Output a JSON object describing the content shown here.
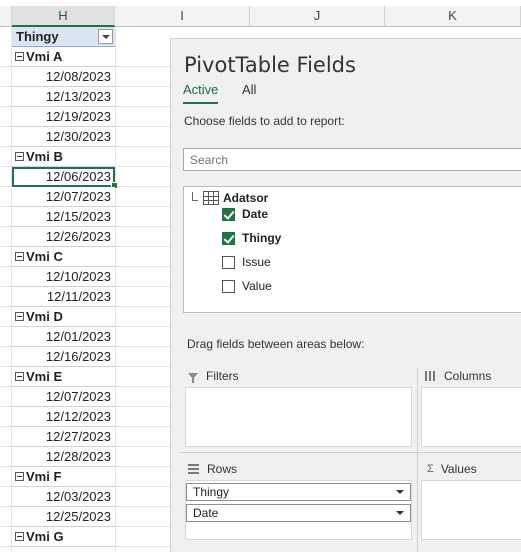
{
  "sheet": {
    "columns": [
      "H",
      "I",
      "J",
      "K"
    ],
    "header_label": "Thingy",
    "rows": [
      {
        "type": "group",
        "text": "Vmi A"
      },
      {
        "type": "date",
        "text": "12/08/2023"
      },
      {
        "type": "date",
        "text": "12/13/2023"
      },
      {
        "type": "date",
        "text": "12/19/2023"
      },
      {
        "type": "date",
        "text": "12/30/2023"
      },
      {
        "type": "group",
        "text": "Vmi B"
      },
      {
        "type": "date",
        "text": "12/06/2023",
        "active": true
      },
      {
        "type": "date",
        "text": "12/07/2023"
      },
      {
        "type": "date",
        "text": "12/15/2023"
      },
      {
        "type": "date",
        "text": "12/26/2023"
      },
      {
        "type": "group",
        "text": "Vmi C"
      },
      {
        "type": "date",
        "text": "12/10/2023"
      },
      {
        "type": "date",
        "text": "12/11/2023"
      },
      {
        "type": "group",
        "text": "Vmi D"
      },
      {
        "type": "date",
        "text": "12/01/2023"
      },
      {
        "type": "date",
        "text": "12/16/2023"
      },
      {
        "type": "group",
        "text": "Vmi E"
      },
      {
        "type": "date",
        "text": "12/07/2023"
      },
      {
        "type": "date",
        "text": "12/12/2023"
      },
      {
        "type": "date",
        "text": "12/27/2023"
      },
      {
        "type": "date",
        "text": "12/28/2023"
      },
      {
        "type": "group",
        "text": "Vmi F"
      },
      {
        "type": "date",
        "text": "12/03/2023"
      },
      {
        "type": "date",
        "text": "12/25/2023"
      },
      {
        "type": "group",
        "text": "Vmi G"
      }
    ]
  },
  "pivot": {
    "title": "PivotTable Fields",
    "tabs": [
      "Active",
      "All"
    ],
    "active_tab": "Active",
    "instruction": "Choose fields to add to report:",
    "search_placeholder": "Search",
    "table_name": "Adatsor",
    "fields": [
      {
        "name": "Date",
        "checked": true
      },
      {
        "name": "Thingy",
        "checked": true
      },
      {
        "name": "Issue",
        "checked": false
      },
      {
        "name": "Value",
        "checked": false
      }
    ],
    "drag_label": "Drag fields between areas below:",
    "areas": {
      "filters": "Filters",
      "columns": "Columns",
      "rows": "Rows",
      "values": "Values"
    },
    "row_fields": [
      "Thingy",
      "Date"
    ]
  },
  "colors": {
    "accent": "#217346",
    "header_fill": "#dbe4f3"
  }
}
